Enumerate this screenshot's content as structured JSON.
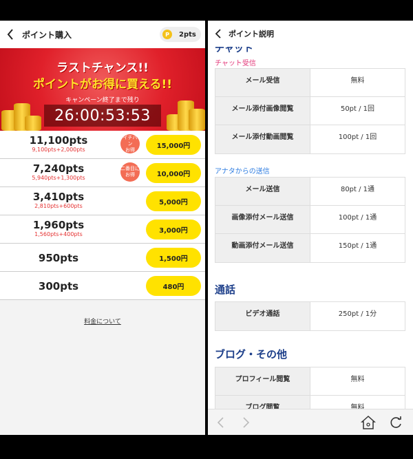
{
  "left": {
    "header": {
      "title": "ポイント購入",
      "points": "2pts",
      "coin_glyph": "P"
    },
    "banner": {
      "line1": "ラストチャンス!!",
      "line2": "ポイントがお得に買える!!",
      "line3": "キャンペーン終了まで残り",
      "countdown": "26:00:53:53"
    },
    "packages": [
      {
        "pts": "11,100pts",
        "detail": "9,100pts+2,000pts",
        "price": "15,000円",
        "tag": [
          "イチバン",
          "お得"
        ]
      },
      {
        "pts": "7,240pts",
        "detail": "5,940pts+1,300pts",
        "price": "10,000円",
        "tag": [
          "二番目に",
          "お得"
        ]
      },
      {
        "pts": "3,410pts",
        "detail": "2,810pts+600pts",
        "price": "5,000円"
      },
      {
        "pts": "1,960pts",
        "detail": "1,560pts+400pts",
        "price": "3,000円"
      },
      {
        "pts": "950pts",
        "price": "1,500円"
      },
      {
        "pts": "300pts",
        "price": "480円"
      }
    ],
    "fee_link": "料金について"
  },
  "right": {
    "header": {
      "title": "ポイント説明"
    },
    "partial_heading": "チャット",
    "sections": {
      "chat_receive": {
        "heading": "チャット受信",
        "rows": [
          {
            "label": "メール受信",
            "value": "無料"
          },
          {
            "label": "メール添付画像閲覧",
            "value": "50pt / 1回"
          },
          {
            "label": "メール添付動画閲覧",
            "value": "100pt / 1回"
          }
        ]
      },
      "send": {
        "heading": "アナタからの送信",
        "rows": [
          {
            "label": "メール送信",
            "value": "80pt / 1通"
          },
          {
            "label": "画像添付メール送信",
            "value": "100pt / 1通"
          },
          {
            "label": "動画添付メール送信",
            "value": "150pt / 1通"
          }
        ]
      },
      "call": {
        "heading": "通話",
        "rows": [
          {
            "label": "ビデオ通話",
            "value": "250pt / 1分"
          }
        ]
      },
      "blog": {
        "heading": "ブログ・その他",
        "rows": [
          {
            "label": "プロフィール閲覧",
            "value": "無料"
          },
          {
            "label": "ブログ閲覧",
            "value": "無料"
          }
        ]
      }
    }
  },
  "colors": {
    "accent_yellow": "#ffe200",
    "banner_red": "#e0202a",
    "heading_blue": "#1d3f8a",
    "pink": "#e3397a",
    "link_blue": "#2f7de1"
  }
}
